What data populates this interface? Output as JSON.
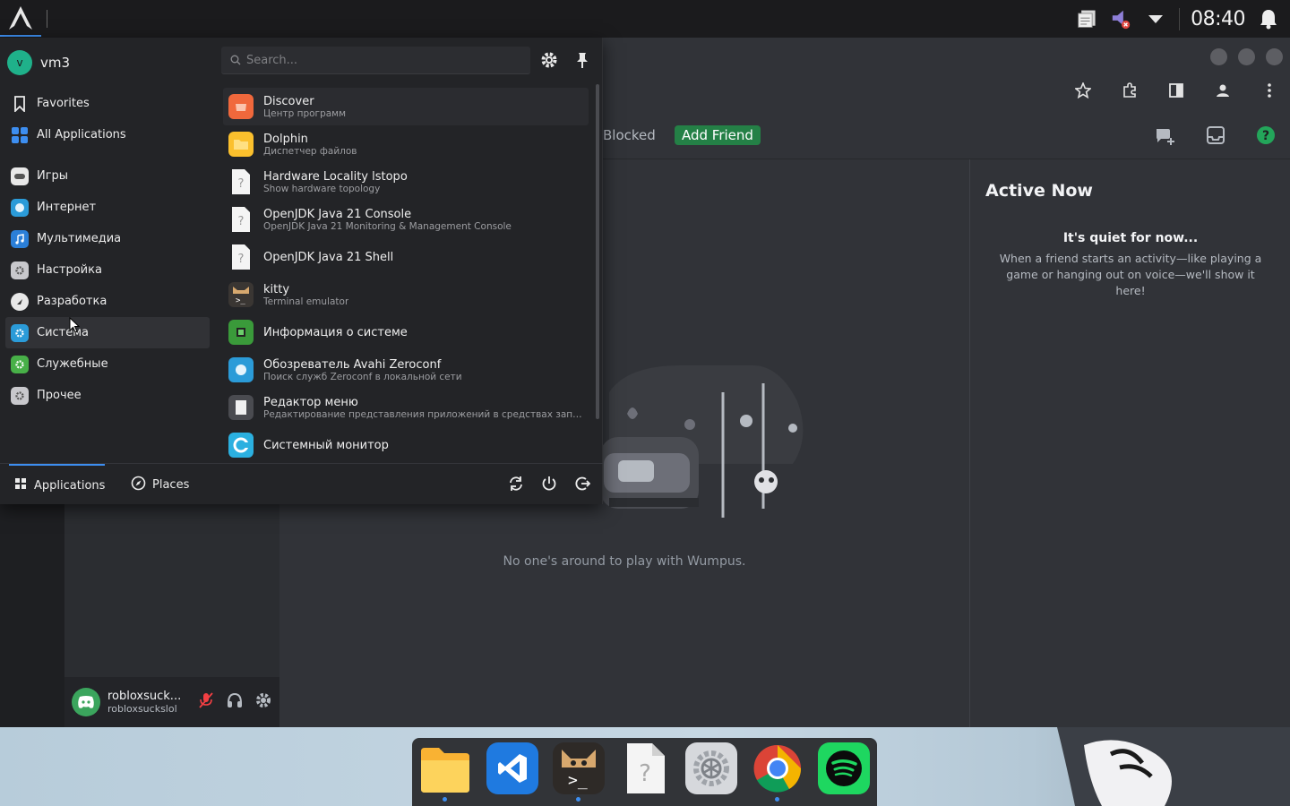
{
  "top_panel": {
    "clock": "08:40"
  },
  "launcher": {
    "user": {
      "initial": "v",
      "name": "vm3"
    },
    "search": {
      "placeholder": "Search..."
    },
    "categories": [
      {
        "label": "Favorites"
      },
      {
        "label": "All Applications"
      },
      {
        "label": "Игры"
      },
      {
        "label": "Интернет"
      },
      {
        "label": "Мультимедиа"
      },
      {
        "label": "Настройка"
      },
      {
        "label": "Разработка"
      },
      {
        "label": "Система"
      },
      {
        "label": "Служебные"
      },
      {
        "label": "Прочее"
      }
    ],
    "apps": [
      {
        "name": "Discover",
        "desc": "Центр программ"
      },
      {
        "name": "Dolphin",
        "desc": "Диспетчер файлов"
      },
      {
        "name": "Hardware Locality lstopo",
        "desc": "Show hardware topology"
      },
      {
        "name": "OpenJDK Java 21 Console",
        "desc": "OpenJDK Java 21 Monitoring & Management Console"
      },
      {
        "name": "OpenJDK Java 21 Shell",
        "desc": ""
      },
      {
        "name": "kitty",
        "desc": "Terminal emulator"
      },
      {
        "name": "Информация о системе",
        "desc": ""
      },
      {
        "name": "Обозреватель Avahi Zeroconf",
        "desc": "Поиск служб Zeroconf в локальной сети"
      },
      {
        "name": "Редактор меню",
        "desc": "Редактирование представления приложений в средствах запуск..."
      },
      {
        "name": "Системный монитор",
        "desc": ""
      }
    ],
    "footer": {
      "applications_tab": "Applications",
      "places_tab": "Places"
    }
  },
  "discord": {
    "tabs": {
      "blocked": "Blocked",
      "add_friend": "Add Friend"
    },
    "active_now": {
      "title": "Active Now",
      "quiet_title": "It's quiet for now...",
      "quiet_desc": "When a friend starts an activity—like playing a game or hanging out on voice—we'll show it here!"
    },
    "empty_state": "No one's around to play with Wumpus.",
    "user_panel": {
      "display_name": "robloxsuck...",
      "username": "robloxsuckslol"
    }
  },
  "colors": {
    "accent": "#3d8ef0",
    "discord_green": "#248046",
    "discord_bg": "#313338"
  },
  "dock": {
    "items": [
      "folder-icon",
      "vscode-icon",
      "kitty-icon",
      "unknown-file-icon",
      "settings-icon",
      "chrome-icon",
      "spotify-icon"
    ]
  }
}
